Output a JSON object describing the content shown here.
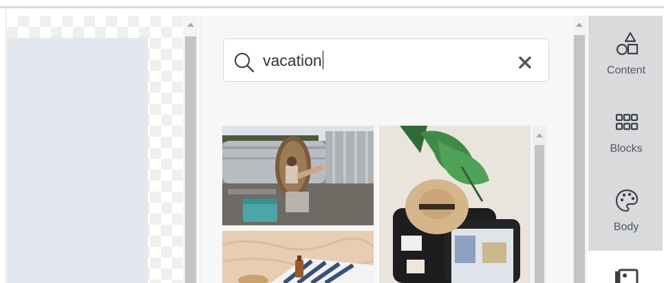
{
  "search": {
    "value": "vacation",
    "search_icon": "search-icon",
    "clear_icon": "close-icon"
  },
  "results": [
    {
      "name": "vacation-photo-rv-hanging-chair"
    },
    {
      "name": "vacation-photo-suitcase-hat"
    },
    {
      "name": "vacation-photo-beach-towel"
    }
  ],
  "rail": {
    "items": [
      {
        "label": "Content",
        "icon": "shapes-icon"
      },
      {
        "label": "Blocks",
        "icon": "grid-icon"
      },
      {
        "label": "Body",
        "icon": "palette-icon"
      },
      {
        "label": "",
        "icon": "image-icon"
      }
    ]
  },
  "colors": {
    "rail_bg": "#d9dadc",
    "panel_bg": "#f7f7f7",
    "canvas_block": "#e3e7ee"
  }
}
